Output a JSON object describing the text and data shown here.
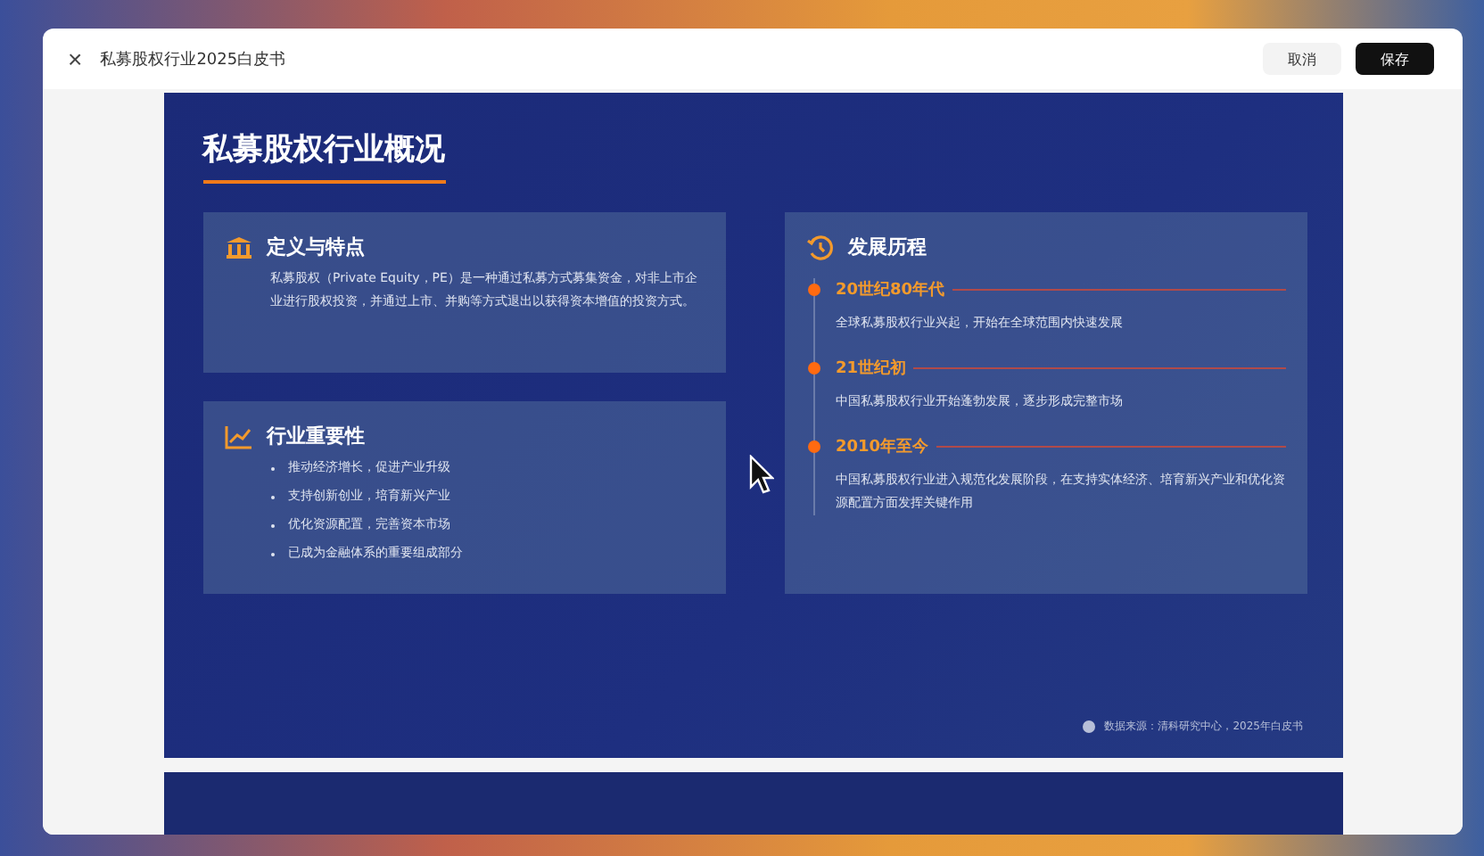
{
  "window": {
    "close": "×",
    "title": "私募股权行业2025白皮书",
    "buttons": [
      {
        "label": "取消",
        "kind": "secondary"
      },
      {
        "label": "保存",
        "kind": "primary"
      }
    ]
  },
  "slide": {
    "title": "私募股权行业概况",
    "definition": {
      "title": "定义与特点",
      "text": "私募股权（Private Equity，PE）是一种通过私募方式募集资金，对非上市企业进行股权投资，并通过上市、并购等方式退出以获得资本增值的投资方式。"
    },
    "importance": {
      "title": "行业重要性",
      "items": [
        "推动经济增长，促进产业升级",
        "支持创新创业，培育新兴产业",
        "优化资源配置，完善资本市场",
        "已成为金融体系的重要组成部分"
      ]
    },
    "history": {
      "title": "发展历程",
      "events": [
        {
          "period": "20世纪80年代",
          "text": "全球私募股权行业兴起，开始在全球范围内快速发展"
        },
        {
          "period": "21世纪初",
          "text": "中国私募股权行业开始蓬勃发展，逐步形成完整市场"
        },
        {
          "period": "2010年至今",
          "text": "中国私募股权行业进入规范化发展阶段，在支持实体经济、培育新兴产业和优化资源配置方面发挥关键作用"
        }
      ]
    },
    "source": "数据来源：清科研究中心，2025年白皮书"
  }
}
